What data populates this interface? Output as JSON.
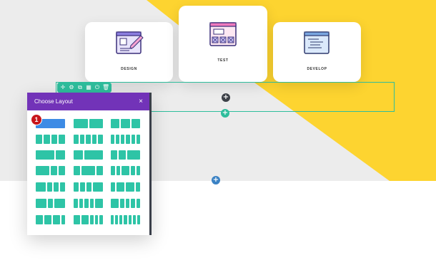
{
  "cards": [
    {
      "label": "DESIGN"
    },
    {
      "label": "TEST"
    },
    {
      "label": "DEVELOP"
    }
  ],
  "colors": {
    "background_gray": "#ececec",
    "accent_yellow": "#fdd430",
    "teal": "#2ebd9c",
    "purple_header": "#7233b8",
    "layout_block": "#2ec4a6",
    "selected_block": "#3d8be5",
    "badge_red": "#c8151b",
    "add_blue": "#3b82c4",
    "dark_add": "#3c4047"
  },
  "row_toolbar": {
    "icons": [
      "move-icon",
      "gear-icon",
      "duplicate-icon",
      "columns-icon",
      "power-icon",
      "trash-icon"
    ],
    "glyphs": [
      "✛",
      "⚙",
      "⧉",
      "▦",
      "⏻",
      "🗑"
    ]
  },
  "buttons": {
    "add_module": "+",
    "add_row": "+",
    "add_section": "+"
  },
  "modal": {
    "title": "Choose Layout",
    "close": "×",
    "badge": "1"
  },
  "layouts": [
    [
      1
    ],
    [
      1,
      1
    ],
    [
      1,
      1,
      1
    ],
    [
      1,
      1,
      1,
      1
    ],
    [
      1,
      1,
      1,
      1,
      1
    ],
    [
      1,
      1,
      1,
      1,
      1,
      1
    ],
    [
      2,
      1
    ],
    [
      1,
      2
    ],
    [
      1,
      1,
      2
    ],
    [
      2,
      1,
      1
    ],
    [
      1,
      2,
      1
    ],
    [
      1,
      1,
      2,
      1,
      1
    ],
    [
      2,
      1,
      1,
      1
    ],
    [
      1,
      1,
      1,
      2
    ],
    [
      1,
      2,
      2,
      1
    ],
    [
      2,
      1,
      2
    ],
    [
      1,
      1,
      1,
      1,
      2
    ],
    [
      2,
      1,
      1,
      1,
      1
    ],
    [
      2,
      2,
      2,
      1
    ],
    [
      2,
      2,
      1,
      1,
      1
    ],
    [
      1,
      1,
      1,
      1,
      1,
      1,
      1
    ]
  ]
}
